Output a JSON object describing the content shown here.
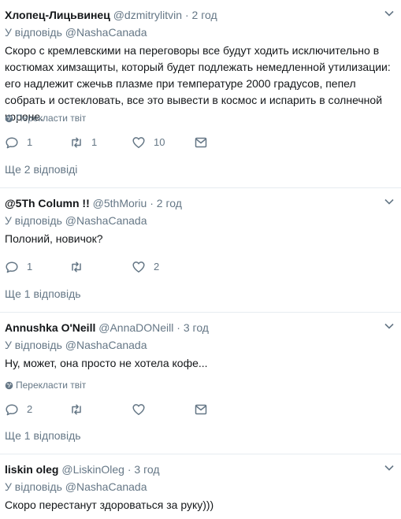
{
  "tweets": [
    {
      "name": "Хлопец-Лицьвинец",
      "handle": "@dzmitrylitvin",
      "dot": "·",
      "time": "2 год",
      "reply_prefix": "У відповідь",
      "reply_mention": "@NashaCanada",
      "text": "Скоро с кремлевскими на переговоры все будут ходить исключительно в костюмах химзащиты, который будет подлежать немедленной утилизации: его надлежит сжечьв плазме при температуре 2000 градусов, пепел собрать и остекловать, все это вывести в космос и испарить  в солнечной короне.",
      "translate": "Перекласти твіт",
      "replies": "1",
      "retweets": "1",
      "likes": "10",
      "more": "Ще 2 відповіді"
    },
    {
      "name": "@5Th Column !!",
      "handle": "@5thMoriu",
      "dot": "·",
      "time": "2 год",
      "reply_prefix": "У відповідь",
      "reply_mention": "@NashaCanada",
      "text": "Полоний, новичок?",
      "replies": "1",
      "retweets": "",
      "likes": "2",
      "more": "Ще 1 відповідь"
    },
    {
      "name": "Annushka O'Neill",
      "handle": "@AnnaDONeill",
      "dot": "·",
      "time": "3 год",
      "reply_prefix": "У відповідь",
      "reply_mention": "@NashaCanada",
      "text": "Ну, может, она просто не хотела кофе...",
      "translate": "Перекласти твіт",
      "replies": "2",
      "retweets": "",
      "likes": "",
      "more": "Ще 1 відповідь"
    },
    {
      "name": "liskin oleg",
      "handle": "@LiskinOleg",
      "dot": "·",
      "time": "3 год",
      "reply_prefix": "У відповідь",
      "reply_mention": "@NashaCanada",
      "text": "Скоро перестанут здороваться за руку)))"
    }
  ]
}
